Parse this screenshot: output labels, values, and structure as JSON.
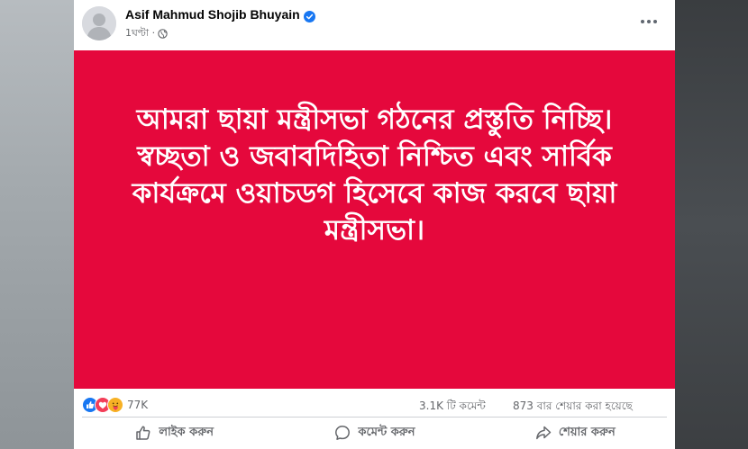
{
  "post": {
    "author": "Asif Mahmud Shojib Bhuyain",
    "time": "1ঘণ্টা ·",
    "text_lines": [
      "আমরা ছায়া মন্ত্রীসভা গঠনের প্রস্তুতি নিচ্ছি।",
      "স্বচ্ছতা ও জবাবদিহিতা নিশ্চিত এবং সার্বিক",
      "কার্যক্রমে ওয়াচডগ হিসেবে কাজ করবে ছায়া",
      "মন্ত্রীসভা।"
    ],
    "background_color": "#e5083c"
  },
  "stats": {
    "reaction_count": "77K",
    "comments": "3.1K টি কমেন্ট",
    "shares": "873 বার শেয়ার করা হয়েছে"
  },
  "actions": {
    "like": "লাইক করুন",
    "comment": "কমেন্ট করুন",
    "share": "শেয়ার করুন"
  },
  "icons": {
    "verified": "verified-badge-icon",
    "globe": "globe-icon",
    "more": "more-options-icon",
    "reactions": [
      "like-reaction-icon",
      "love-reaction-icon",
      "care-reaction-icon"
    ]
  },
  "colors": {
    "accent": "#1877f2",
    "love": "#f33e58",
    "care": "#f7b125"
  }
}
